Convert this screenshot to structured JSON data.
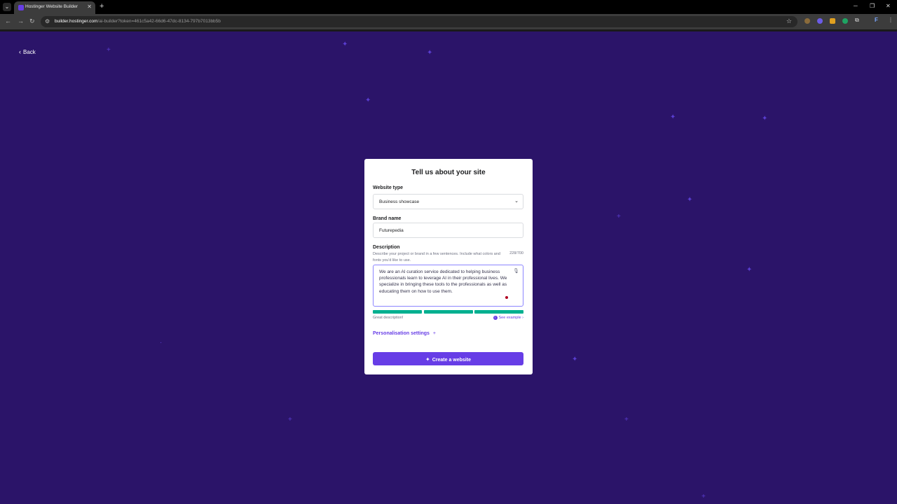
{
  "browser": {
    "tab_title": "Hostinger Website Builder",
    "url_domain": "builder.hostinger.com",
    "url_path": "/ai-builder?token=461c5a42-66d6-47dc-8134-797b7013bb5b",
    "extension_badge": "F"
  },
  "page": {
    "back_label": "Back",
    "form": {
      "title": "Tell us about your site",
      "website_type": {
        "label": "Website type",
        "value": "Business showcase"
      },
      "brand_name": {
        "label": "Brand name",
        "value": "Futurepedia"
      },
      "description": {
        "label": "Description",
        "hint": "Describe your project or brand in a few sentences. Include what colors and fonts you'd like to use.",
        "counter": "228/700",
        "value": "We are an AI curation service dedicated to helping business professionals learn to leverage AI in their professional lives. We specialize in bringing these tools to the professionals as well as educating them on how to use them.",
        "quality_bars_filled": 3,
        "feedback": "Great description!",
        "see_example": "See example"
      },
      "personalisation_label": "Personalisation settings",
      "create_button_label": "Create a website"
    }
  },
  "colors": {
    "background": "#2b1469",
    "accent": "#673de6",
    "quality": "#00b090"
  }
}
